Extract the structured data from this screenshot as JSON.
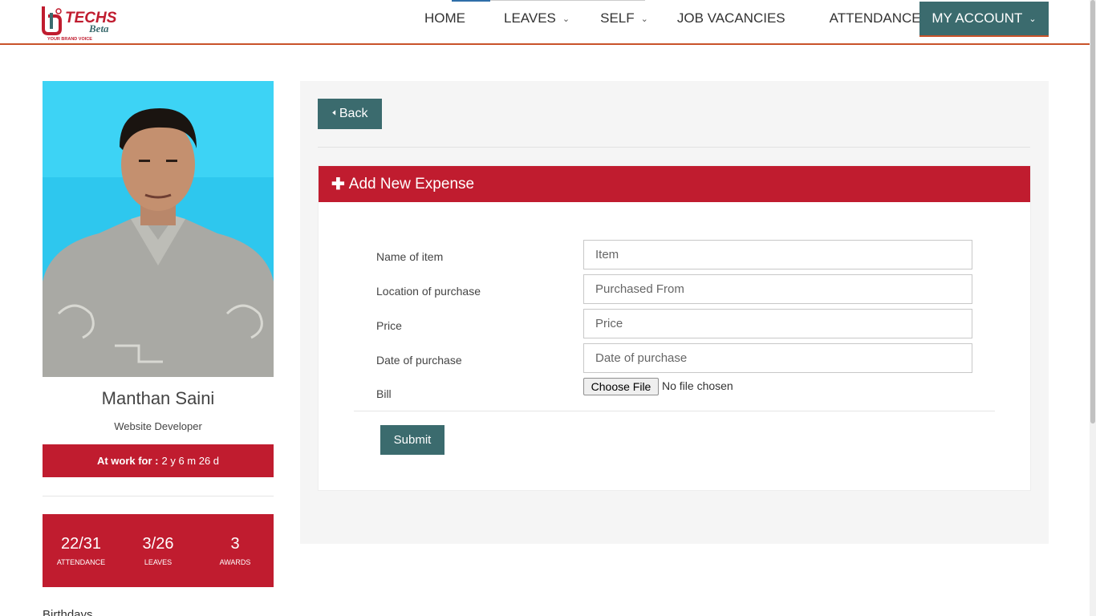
{
  "brand": {
    "name": "TECHS",
    "sub": "Beta",
    "tagline": "YOUR BRAND VOICE"
  },
  "nav": {
    "home": "HOME",
    "leaves": "LEAVES",
    "self": "SELF",
    "jobs": "JOB VACANCIES",
    "attendance": "ATTENDANCE",
    "account": "MY ACCOUNT"
  },
  "profile": {
    "name": "Manthan Saini",
    "role": "Website Developer",
    "at_work_label": "At work for :",
    "at_work_value": "2 y 6 m 26 d",
    "stats": [
      {
        "value": "22/31",
        "label": "ATTENDANCE"
      },
      {
        "value": "3/26",
        "label": "LEAVES"
      },
      {
        "value": "3",
        "label": "AWARDS"
      }
    ],
    "birthday": "Birthdays"
  },
  "main": {
    "back_label": "Back",
    "card_title": "Add New Expense",
    "fields": [
      {
        "label": "Name of item",
        "placeholder": "Item"
      },
      {
        "label": "Location of purchase",
        "placeholder": "Purchased From"
      },
      {
        "label": "Price",
        "placeholder": "Price"
      },
      {
        "label": "Date of purchase",
        "placeholder": "Date of purchase"
      }
    ],
    "bill_label": "Bill",
    "file_button": "Choose File",
    "file_status": "No file chosen",
    "submit_label": "Submit"
  },
  "colors": {
    "primary": "#3b6b6e",
    "accent": "#c01c2f",
    "header_border": "#c9532a"
  }
}
